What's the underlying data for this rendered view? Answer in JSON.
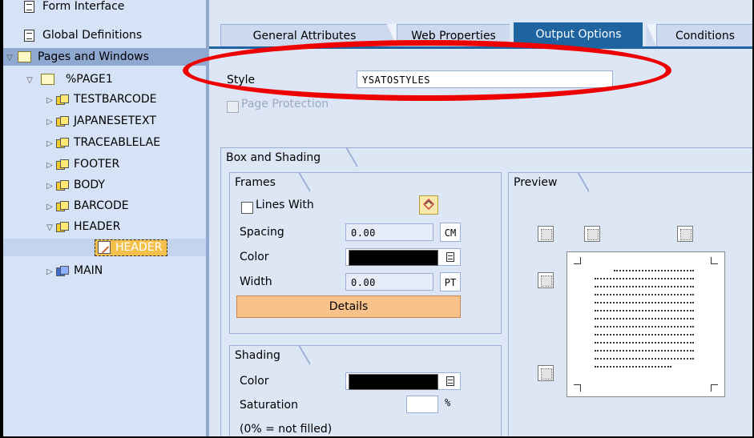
{
  "tree": {
    "items": [
      {
        "label": "Form Interface",
        "arrow": "",
        "icon": "document-icon"
      },
      {
        "label": "Global Definitions",
        "arrow": "",
        "icon": "document-icon"
      },
      {
        "label": "Pages and Windows",
        "arrow": "▽",
        "icon": "folder-icon"
      },
      {
        "label": "%PAGE1",
        "arrow": "▽",
        "icon": "folder-icon"
      },
      {
        "label": "TESTBARCODE",
        "arrow": "▷",
        "icon": "window-icon"
      },
      {
        "label": "JAPANESETEXT",
        "arrow": "▷",
        "icon": "window-icon"
      },
      {
        "label": "TRACEABLELAE",
        "arrow": "▷",
        "icon": "window-icon"
      },
      {
        "label": "FOOTER",
        "arrow": "▷",
        "icon": "window-icon"
      },
      {
        "label": "BODY",
        "arrow": "▷",
        "icon": "window-icon"
      },
      {
        "label": "BARCODE",
        "arrow": "▷",
        "icon": "window-icon"
      },
      {
        "label": "HEADER",
        "arrow": "▽",
        "icon": "window-icon"
      },
      {
        "label": "HEADER",
        "arrow": "",
        "icon": "text-node-icon"
      },
      {
        "label": "MAIN",
        "arrow": "▷",
        "icon": "main-window-icon"
      }
    ]
  },
  "tabs": [
    {
      "label": "General Attributes"
    },
    {
      "label": "Web Properties"
    },
    {
      "label": "Output Options"
    },
    {
      "label": "Conditions"
    }
  ],
  "active_tab": "Output Options",
  "style": {
    "label": "Style",
    "value": "YSATOSTYLES"
  },
  "page_protection": {
    "label": "Page Protection",
    "checked": false,
    "enabled": false
  },
  "box_shading": {
    "title": "Box and Shading",
    "frames": {
      "title": "Frames",
      "lines_with_label": "Lines With",
      "lines_with_checked": false,
      "spacing_label": "Spacing",
      "spacing_value": "0.00",
      "spacing_unit": "CM",
      "color_label": "Color",
      "color_value": "#000000",
      "width_label": "Width",
      "width_value": "0.00",
      "width_unit": "PT",
      "details_label": "Details"
    },
    "shading": {
      "title": "Shading",
      "color_label": "Color",
      "color_value": "#000000",
      "saturation_label": "Saturation",
      "saturation_value": "",
      "saturation_unit": "%",
      "note": "(0% = not filled)"
    },
    "preview": {
      "title": "Preview"
    }
  },
  "colors": {
    "active_tab": "#1e64a0",
    "button": "#f8c28a",
    "annotation": "#e00000",
    "selection": "#f3c04c"
  }
}
